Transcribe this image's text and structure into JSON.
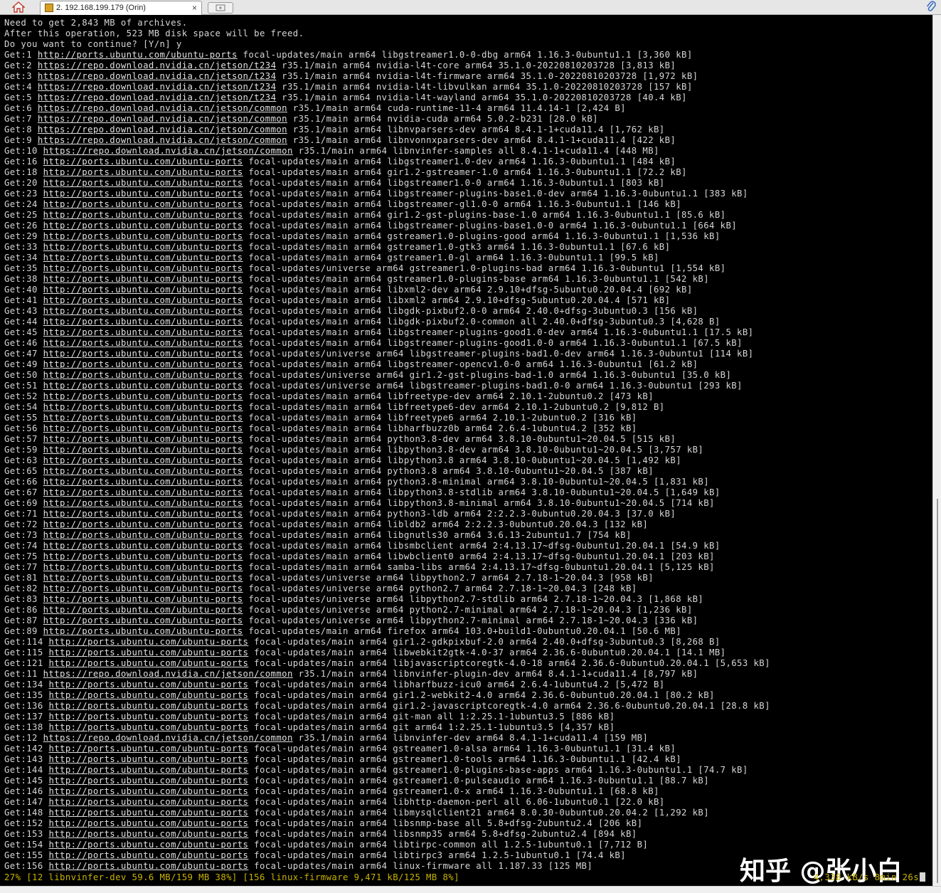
{
  "tab": {
    "title": "2. 192.168.199.179 (Orin)",
    "close_label": "×"
  },
  "terminal": {
    "lines": [
      {
        "text": "Need to get 2,843 MB of archives."
      },
      {
        "text": "After this operation, 523 MB disk space will be freed."
      },
      {
        "text": "Do you want to continue? [Y/n] y"
      },
      {
        "pre": "Get:1 ",
        "url": "http://ports.ubuntu.com/ubuntu-ports",
        "post": " focal-updates/main arm64 libgstreamer1.0-0-dbg arm64 1.16.3-0ubuntu1.1 [3,360 kB]"
      },
      {
        "pre": "Get:2 ",
        "url": "https://repo.download.nvidia.cn/jetson/t234",
        "post": " r35.1/main arm64 nvidia-l4t-core arm64 35.1.0-20220810203728 [3,813 kB]"
      },
      {
        "pre": "Get:3 ",
        "url": "https://repo.download.nvidia.cn/jetson/t234",
        "post": " r35.1/main arm64 nvidia-l4t-firmware arm64 35.1.0-20220810203728 [1,972 kB]"
      },
      {
        "pre": "Get:4 ",
        "url": "https://repo.download.nvidia.cn/jetson/t234",
        "post": " r35.1/main arm64 nvidia-l4t-libvulkan arm64 35.1.0-20220810203728 [157 kB]"
      },
      {
        "pre": "Get:5 ",
        "url": "https://repo.download.nvidia.cn/jetson/t234",
        "post": " r35.1/main arm64 nvidia-l4t-wayland arm64 35.1.0-20220810203728 [40.4 kB]"
      },
      {
        "pre": "Get:6 ",
        "url": "https://repo.download.nvidia.cn/jetson/common",
        "post": " r35.1/main arm64 cuda-runtime-11-4 arm64 11.4.14-1 [2,424 B]"
      },
      {
        "pre": "Get:7 ",
        "url": "https://repo.download.nvidia.cn/jetson/common",
        "post": " r35.1/main arm64 nvidia-cuda arm64 5.0.2-b231 [28.0 kB]"
      },
      {
        "pre": "Get:8 ",
        "url": "https://repo.download.nvidia.cn/jetson/common",
        "post": " r35.1/main arm64 libnvparsers-dev arm64 8.4.1-1+cuda11.4 [1,762 kB]"
      },
      {
        "pre": "Get:9 ",
        "url": "https://repo.download.nvidia.cn/jetson/common",
        "post": " r35.1/main arm64 libnvonnxparsers-dev arm64 8.4.1-1+cuda11.4 [422 kB]"
      },
      {
        "pre": "Get:10 ",
        "url": "https://repo.download.nvidia.cn/jetson/common",
        "post": " r35.1/main arm64 libnvinfer-samples all 8.4.1-1+cuda11.4 [448 MB]"
      },
      {
        "pre": "Get:16 ",
        "url": "http://ports.ubuntu.com/ubuntu-ports",
        "post": " focal-updates/main arm64 libgstreamer1.0-dev arm64 1.16.3-0ubuntu1.1 [484 kB]"
      },
      {
        "pre": "Get:18 ",
        "url": "http://ports.ubuntu.com/ubuntu-ports",
        "post": " focal-updates/main arm64 gir1.2-gstreamer-1.0 arm64 1.16.3-0ubuntu1.1 [72.2 kB]"
      },
      {
        "pre": "Get:20 ",
        "url": "http://ports.ubuntu.com/ubuntu-ports",
        "post": " focal-updates/main arm64 libgstreamer1.0-0 arm64 1.16.3-0ubuntu1.1 [803 kB]"
      },
      {
        "pre": "Get:23 ",
        "url": "http://ports.ubuntu.com/ubuntu-ports",
        "post": " focal-updates/main arm64 libgstreamer-plugins-base1.0-dev arm64 1.16.3-0ubuntu1.1 [383 kB]"
      },
      {
        "pre": "Get:24 ",
        "url": "http://ports.ubuntu.com/ubuntu-ports",
        "post": " focal-updates/main arm64 libgstreamer-gl1.0-0 arm64 1.16.3-0ubuntu1.1 [146 kB]"
      },
      {
        "pre": "Get:25 ",
        "url": "http://ports.ubuntu.com/ubuntu-ports",
        "post": " focal-updates/main arm64 gir1.2-gst-plugins-base-1.0 arm64 1.16.3-0ubuntu1.1 [85.6 kB]"
      },
      {
        "pre": "Get:26 ",
        "url": "http://ports.ubuntu.com/ubuntu-ports",
        "post": " focal-updates/main arm64 libgstreamer-plugins-base1.0-0 arm64 1.16.3-0ubuntu1.1 [664 kB]"
      },
      {
        "pre": "Get:29 ",
        "url": "http://ports.ubuntu.com/ubuntu-ports",
        "post": " focal-updates/main arm64 gstreamer1.0-plugins-good arm64 1.16.3-0ubuntu1.1 [1,536 kB]"
      },
      {
        "pre": "Get:33 ",
        "url": "http://ports.ubuntu.com/ubuntu-ports",
        "post": " focal-updates/main arm64 gstreamer1.0-gtk3 arm64 1.16.3-0ubuntu1.1 [67.6 kB]"
      },
      {
        "pre": "Get:34 ",
        "url": "http://ports.ubuntu.com/ubuntu-ports",
        "post": " focal-updates/main arm64 gstreamer1.0-gl arm64 1.16.3-0ubuntu1.1 [99.5 kB]"
      },
      {
        "pre": "Get:35 ",
        "url": "http://ports.ubuntu.com/ubuntu-ports",
        "post": " focal-updates/universe arm64 gstreamer1.0-plugins-bad arm64 1.16.3-0ubuntu1 [1,554 kB]"
      },
      {
        "pre": "Get:38 ",
        "url": "http://ports.ubuntu.com/ubuntu-ports",
        "post": " focal-updates/main arm64 gstreamer1.0-plugins-base arm64 1.16.3-0ubuntu1.1 [542 kB]"
      },
      {
        "pre": "Get:40 ",
        "url": "http://ports.ubuntu.com/ubuntu-ports",
        "post": " focal-updates/main arm64 libxml2-dev arm64 2.9.10+dfsg-5ubuntu0.20.04.4 [692 kB]"
      },
      {
        "pre": "Get:41 ",
        "url": "http://ports.ubuntu.com/ubuntu-ports",
        "post": " focal-updates/main arm64 libxml2 arm64 2.9.10+dfsg-5ubuntu0.20.04.4 [571 kB]"
      },
      {
        "pre": "Get:43 ",
        "url": "http://ports.ubuntu.com/ubuntu-ports",
        "post": " focal-updates/main arm64 libgdk-pixbuf2.0-0 arm64 2.40.0+dfsg-3ubuntu0.3 [156 kB]"
      },
      {
        "pre": "Get:44 ",
        "url": "http://ports.ubuntu.com/ubuntu-ports",
        "post": " focal-updates/main arm64 libgdk-pixbuf2.0-common all 2.40.0+dfsg-3ubuntu0.3 [4,628 B]"
      },
      {
        "pre": "Get:45 ",
        "url": "http://ports.ubuntu.com/ubuntu-ports",
        "post": " focal-updates/main arm64 libgstreamer-plugins-good1.0-dev arm64 1.16.3-0ubuntu1.1 [17.5 kB]"
      },
      {
        "pre": "Get:46 ",
        "url": "http://ports.ubuntu.com/ubuntu-ports",
        "post": " focal-updates/main arm64 libgstreamer-plugins-good1.0-0 arm64 1.16.3-0ubuntu1.1 [67.5 kB]"
      },
      {
        "pre": "Get:47 ",
        "url": "http://ports.ubuntu.com/ubuntu-ports",
        "post": " focal-updates/universe arm64 libgstreamer-plugins-bad1.0-dev arm64 1.16.3-0ubuntu1 [114 kB]"
      },
      {
        "pre": "Get:49 ",
        "url": "http://ports.ubuntu.com/ubuntu-ports",
        "post": " focal-updates/main arm64 libgstreamer-opencv1.0-0 arm64 1.16.3-0ubuntu1 [61.2 kB]"
      },
      {
        "pre": "Get:50 ",
        "url": "http://ports.ubuntu.com/ubuntu-ports",
        "post": " focal-updates/universe arm64 gir1.2-gst-plugins-bad-1.0 arm64 1.16.3-0ubuntu1 [35.0 kB]"
      },
      {
        "pre": "Get:51 ",
        "url": "http://ports.ubuntu.com/ubuntu-ports",
        "post": " focal-updates/universe arm64 libgstreamer-plugins-bad1.0-0 arm64 1.16.3-0ubuntu1 [293 kB]"
      },
      {
        "pre": "Get:52 ",
        "url": "http://ports.ubuntu.com/ubuntu-ports",
        "post": " focal-updates/main arm64 libfreetype-dev arm64 2.10.1-2ubuntu0.2 [473 kB]"
      },
      {
        "pre": "Get:54 ",
        "url": "http://ports.ubuntu.com/ubuntu-ports",
        "post": " focal-updates/main arm64 libfreetype6-dev arm64 2.10.1-2ubuntu0.2 [9,812 B]"
      },
      {
        "pre": "Get:55 ",
        "url": "http://ports.ubuntu.com/ubuntu-ports",
        "post": " focal-updates/main arm64 libfreetype6 arm64 2.10.1-2ubuntu0.2 [316 kB]"
      },
      {
        "pre": "Get:56 ",
        "url": "http://ports.ubuntu.com/ubuntu-ports",
        "post": " focal-updates/main arm64 libharfbuzz0b arm64 2.6.4-1ubuntu4.2 [352 kB]"
      },
      {
        "pre": "Get:57 ",
        "url": "http://ports.ubuntu.com/ubuntu-ports",
        "post": " focal-updates/main arm64 python3.8-dev arm64 3.8.10-0ubuntu1~20.04.5 [515 kB]"
      },
      {
        "pre": "Get:59 ",
        "url": "http://ports.ubuntu.com/ubuntu-ports",
        "post": " focal-updates/main arm64 libpython3.8-dev arm64 3.8.10-0ubuntu1~20.04.5 [3,757 kB]"
      },
      {
        "pre": "Get:63 ",
        "url": "http://ports.ubuntu.com/ubuntu-ports",
        "post": " focal-updates/main arm64 libpython3.8 arm64 3.8.10-0ubuntu1~20.04.5 [1,492 kB]"
      },
      {
        "pre": "Get:65 ",
        "url": "http://ports.ubuntu.com/ubuntu-ports",
        "post": " focal-updates/main arm64 python3.8 arm64 3.8.10-0ubuntu1~20.04.5 [387 kB]"
      },
      {
        "pre": "Get:66 ",
        "url": "http://ports.ubuntu.com/ubuntu-ports",
        "post": " focal-updates/main arm64 python3.8-minimal arm64 3.8.10-0ubuntu1~20.04.5 [1,831 kB]"
      },
      {
        "pre": "Get:67 ",
        "url": "http://ports.ubuntu.com/ubuntu-ports",
        "post": " focal-updates/main arm64 libpython3.8-stdlib arm64 3.8.10-0ubuntu1~20.04.5 [1,649 kB]"
      },
      {
        "pre": "Get:69 ",
        "url": "http://ports.ubuntu.com/ubuntu-ports",
        "post": " focal-updates/main arm64 libpython3.8-minimal arm64 3.8.10-0ubuntu1~20.04.5 [714 kB]"
      },
      {
        "pre": "Get:71 ",
        "url": "http://ports.ubuntu.com/ubuntu-ports",
        "post": " focal-updates/main arm64 python3-ldb arm64 2:2.2.3-0ubuntu0.20.04.3 [37.0 kB]"
      },
      {
        "pre": "Get:72 ",
        "url": "http://ports.ubuntu.com/ubuntu-ports",
        "post": " focal-updates/main arm64 libldb2 arm64 2:2.2.3-0ubuntu0.20.04.3 [132 kB]"
      },
      {
        "pre": "Get:73 ",
        "url": "http://ports.ubuntu.com/ubuntu-ports",
        "post": " focal-updates/main arm64 libgnutls30 arm64 3.6.13-2ubuntu1.7 [754 kB]"
      },
      {
        "pre": "Get:74 ",
        "url": "http://ports.ubuntu.com/ubuntu-ports",
        "post": " focal-updates/main arm64 libsmbclient arm64 2:4.13.17~dfsg-0ubuntu1.20.04.1 [54.9 kB]"
      },
      {
        "pre": "Get:75 ",
        "url": "http://ports.ubuntu.com/ubuntu-ports",
        "post": " focal-updates/main arm64 libwbclient0 arm64 2:4.13.17~dfsg-0ubuntu1.20.04.1 [203 kB]"
      },
      {
        "pre": "Get:77 ",
        "url": "http://ports.ubuntu.com/ubuntu-ports",
        "post": " focal-updates/main arm64 samba-libs arm64 2:4.13.17~dfsg-0ubuntu1.20.04.1 [5,125 kB]"
      },
      {
        "pre": "Get:81 ",
        "url": "http://ports.ubuntu.com/ubuntu-ports",
        "post": " focal-updates/universe arm64 libpython2.7 arm64 2.7.18-1~20.04.3 [958 kB]"
      },
      {
        "pre": "Get:82 ",
        "url": "http://ports.ubuntu.com/ubuntu-ports",
        "post": " focal-updates/universe arm64 python2.7 arm64 2.7.18-1~20.04.3 [248 kB]"
      },
      {
        "pre": "Get:83 ",
        "url": "http://ports.ubuntu.com/ubuntu-ports",
        "post": " focal-updates/universe arm64 libpython2.7-stdlib arm64 2.7.18-1~20.04.3 [1,868 kB]"
      },
      {
        "pre": "Get:86 ",
        "url": "http://ports.ubuntu.com/ubuntu-ports",
        "post": " focal-updates/universe arm64 python2.7-minimal arm64 2.7.18-1~20.04.3 [1,236 kB]"
      },
      {
        "pre": "Get:87 ",
        "url": "http://ports.ubuntu.com/ubuntu-ports",
        "post": " focal-updates/universe arm64 libpython2.7-minimal arm64 2.7.18-1~20.04.3 [336 kB]"
      },
      {
        "pre": "Get:89 ",
        "url": "http://ports.ubuntu.com/ubuntu-ports",
        "post": " focal-updates/main arm64 firefox arm64 103.0+build1-0ubuntu0.20.04.1 [50.6 MB]"
      },
      {
        "pre": "Get:114 ",
        "url": "http://ports.ubuntu.com/ubuntu-ports",
        "post": " focal-updates/main arm64 gir1.2-gdkpixbuf-2.0 arm64 2.40.0+dfsg-3ubuntu0.3 [8,268 B]"
      },
      {
        "pre": "Get:115 ",
        "url": "http://ports.ubuntu.com/ubuntu-ports",
        "post": " focal-updates/main arm64 libwebkit2gtk-4.0-37 arm64 2.36.6-0ubuntu0.20.04.1 [14.1 MB]"
      },
      {
        "pre": "Get:121 ",
        "url": "http://ports.ubuntu.com/ubuntu-ports",
        "post": " focal-updates/main arm64 libjavascriptcoregtk-4.0-18 arm64 2.36.6-0ubuntu0.20.04.1 [5,653 kB]"
      },
      {
        "pre": "Get:11 ",
        "url": "https://repo.download.nvidia.cn/jetson/common",
        "post": " r35.1/main arm64 libnvinfer-plugin-dev arm64 8.4.1-1+cuda11.4 [8,797 kB]"
      },
      {
        "pre": "Get:134 ",
        "url": "http://ports.ubuntu.com/ubuntu-ports",
        "post": " focal-updates/main arm64 libharfbuzz-icu0 arm64 2.6.4-1ubuntu4.2 [5,472 B]"
      },
      {
        "pre": "Get:135 ",
        "url": "http://ports.ubuntu.com/ubuntu-ports",
        "post": " focal-updates/main arm64 gir1.2-webkit2-4.0 arm64 2.36.6-0ubuntu0.20.04.1 [80.2 kB]"
      },
      {
        "pre": "Get:136 ",
        "url": "http://ports.ubuntu.com/ubuntu-ports",
        "post": " focal-updates/main arm64 gir1.2-javascriptcoregtk-4.0 arm64 2.36.6-0ubuntu0.20.04.1 [28.8 kB]"
      },
      {
        "pre": "Get:137 ",
        "url": "http://ports.ubuntu.com/ubuntu-ports",
        "post": " focal-updates/main arm64 git-man all 1:2.25.1-1ubuntu3.5 [886 kB]"
      },
      {
        "pre": "Get:138 ",
        "url": "http://ports.ubuntu.com/ubuntu-ports",
        "post": " focal-updates/main arm64 git arm64 1:2.25.1-1ubuntu3.5 [4,357 kB]"
      },
      {
        "pre": "Get:12 ",
        "url": "https://repo.download.nvidia.cn/jetson/common",
        "post": " r35.1/main arm64 libnvinfer-dev arm64 8.4.1-1+cuda11.4 [159 MB]"
      },
      {
        "pre": "Get:142 ",
        "url": "http://ports.ubuntu.com/ubuntu-ports",
        "post": " focal-updates/main arm64 gstreamer1.0-alsa arm64 1.16.3-0ubuntu1.1 [31.4 kB]"
      },
      {
        "pre": "Get:143 ",
        "url": "http://ports.ubuntu.com/ubuntu-ports",
        "post": " focal-updates/main arm64 gstreamer1.0-tools arm64 1.16.3-0ubuntu1.1 [42.4 kB]"
      },
      {
        "pre": "Get:144 ",
        "url": "http://ports.ubuntu.com/ubuntu-ports",
        "post": " focal-updates/main arm64 gstreamer1.0-plugins-base-apps arm64 1.16.3-0ubuntu1.1 [74.7 kB]"
      },
      {
        "pre": "Get:145 ",
        "url": "http://ports.ubuntu.com/ubuntu-ports",
        "post": " focal-updates/main arm64 gstreamer1.0-pulseaudio arm64 1.16.3-0ubuntu1.1 [88.7 kB]"
      },
      {
        "pre": "Get:146 ",
        "url": "http://ports.ubuntu.com/ubuntu-ports",
        "post": " focal-updates/main arm64 gstreamer1.0-x arm64 1.16.3-0ubuntu1.1 [68.8 kB]"
      },
      {
        "pre": "Get:147 ",
        "url": "http://ports.ubuntu.com/ubuntu-ports",
        "post": " focal-updates/main arm64 libhttp-daemon-perl all 6.06-1ubuntu0.1 [22.0 kB]"
      },
      {
        "pre": "Get:148 ",
        "url": "http://ports.ubuntu.com/ubuntu-ports",
        "post": " focal-updates/main arm64 libmysqlclient21 arm64 8.0.30-0ubuntu0.20.04.2 [1,292 kB]"
      },
      {
        "pre": "Get:152 ",
        "url": "http://ports.ubuntu.com/ubuntu-ports",
        "post": " focal-updates/main arm64 libsnmp-base all 5.8+dfsg-2ubuntu2.4 [206 kB]"
      },
      {
        "pre": "Get:153 ",
        "url": "http://ports.ubuntu.com/ubuntu-ports",
        "post": " focal-updates/main arm64 libsnmp35 arm64 5.8+dfsg-2ubuntu2.4 [894 kB]"
      },
      {
        "pre": "Get:154 ",
        "url": "http://ports.ubuntu.com/ubuntu-ports",
        "post": " focal-updates/main arm64 libtirpc-common all 1.2.5-1ubuntu0.1 [7,712 B]"
      },
      {
        "pre": "Get:155 ",
        "url": "http://ports.ubuntu.com/ubuntu-ports",
        "post": " focal-updates/main arm64 libtirpc3 arm64 1.2.5-1ubuntu0.1 [74.4 kB]"
      },
      {
        "pre": "Get:156 ",
        "url": "http://ports.ubuntu.com/ubuntu-ports",
        "post": " focal-updates/main arm64 linux-firmware all 1.187.33 [125 MB]"
      }
    ],
    "status_left": "27% [12 libnvinfer-dev 59.6 MB/159 MB 38%] [156 linux-firmware 9,471 kB/125 MB 8%]",
    "status_right": "4,338 kB/s 8min 26s"
  },
  "watermark": "知乎 @张小白"
}
